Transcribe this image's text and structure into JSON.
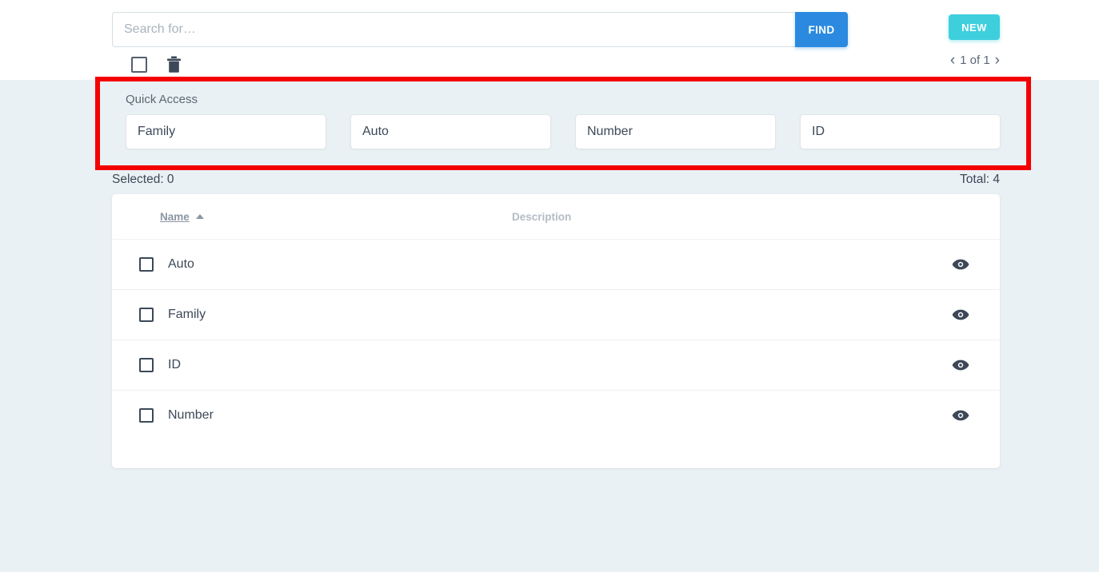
{
  "header": {
    "search": {
      "placeholder": "Search for…",
      "value": ""
    },
    "find_label": "FIND",
    "new_label": "NEW",
    "pagination": {
      "prev_glyph": "‹",
      "next_glyph": "›",
      "label": "1 of 1"
    }
  },
  "quick_access": {
    "label": "Quick Access",
    "items": [
      {
        "label": "Family"
      },
      {
        "label": "Auto"
      },
      {
        "label": "Number"
      },
      {
        "label": "ID"
      }
    ]
  },
  "counts": {
    "selected": "Selected: 0",
    "total": "Total: 4"
  },
  "table": {
    "columns": {
      "name": "Name",
      "description": "Description"
    },
    "sort": {
      "column": "Name",
      "direction": "asc"
    },
    "rows": [
      {
        "name": "Auto",
        "description": ""
      },
      {
        "name": "Family",
        "description": ""
      },
      {
        "name": "ID",
        "description": ""
      },
      {
        "name": "Number",
        "description": ""
      }
    ]
  },
  "colors": {
    "find_button": "#2b8ae0",
    "new_button": "#3ecfdd",
    "highlight_border": "#f40000",
    "page_background": "#eaf1f4",
    "text": "#3c4858"
  },
  "icons": {
    "select_all_checkbox": "checkbox-icon",
    "delete": "trash-icon",
    "row_view": "eye-icon"
  }
}
